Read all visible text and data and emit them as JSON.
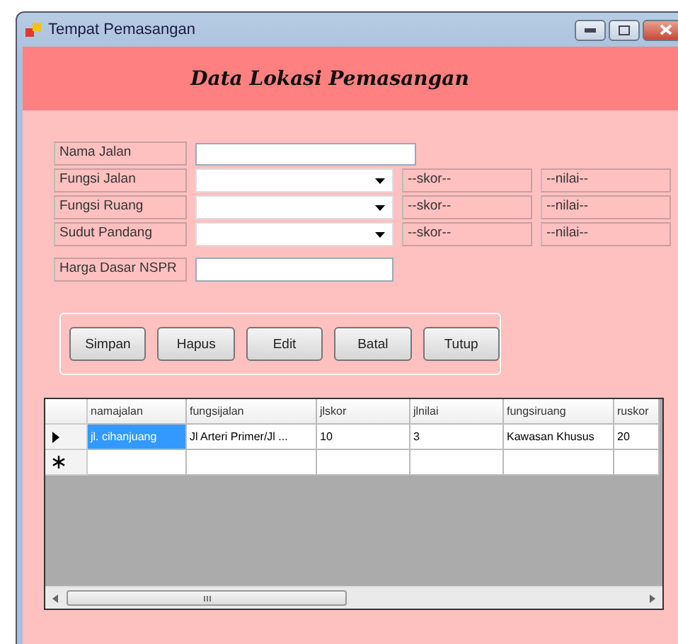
{
  "window": {
    "title": "Tempat Pemasangan"
  },
  "header": {
    "title": "Data Lokasi Pemasangan"
  },
  "fields": [
    {
      "label": "Nama Jalan",
      "kind": "text"
    },
    {
      "label": "Fungsi Jalan",
      "kind": "combo",
      "skor": "--skor--",
      "nilai": "--nilai--"
    },
    {
      "label": "Fungsi Ruang",
      "kind": "combo",
      "skor": "--skor--",
      "nilai": "--nilai--"
    },
    {
      "label": "Sudut Pandang",
      "kind": "combo",
      "skor": "--skor--",
      "nilai": "--nilai--"
    },
    {
      "label": "Harga Dasar NSPR",
      "kind": "short"
    }
  ],
  "buttons": [
    "Simpan",
    "Hapus",
    "Edit",
    "Batal",
    "Tutup"
  ],
  "grid": {
    "columns": [
      "namajalan",
      "fungsijalan",
      "jlskor",
      "jlnilai",
      "fungsiruang",
      "ruskor"
    ],
    "rows": [
      {
        "kind": "current",
        "cells": [
          {
            "text": "jl. cihanjuang",
            "selected": true
          },
          {
            "text": "Jl Arteri Primer/Jl ...",
            "selected": false
          },
          {
            "text": "10",
            "selected": false
          },
          {
            "text": "3",
            "selected": false
          },
          {
            "text": "Kawasan Khusus",
            "selected": false
          },
          {
            "text": "20",
            "selected": false
          }
        ]
      },
      {
        "kind": "new",
        "cells": [
          {
            "selected": false
          },
          {
            "selected": false
          },
          {
            "selected": false
          },
          {
            "selected": false
          },
          {
            "selected": false
          },
          {
            "selected": false
          }
        ]
      }
    ]
  }
}
